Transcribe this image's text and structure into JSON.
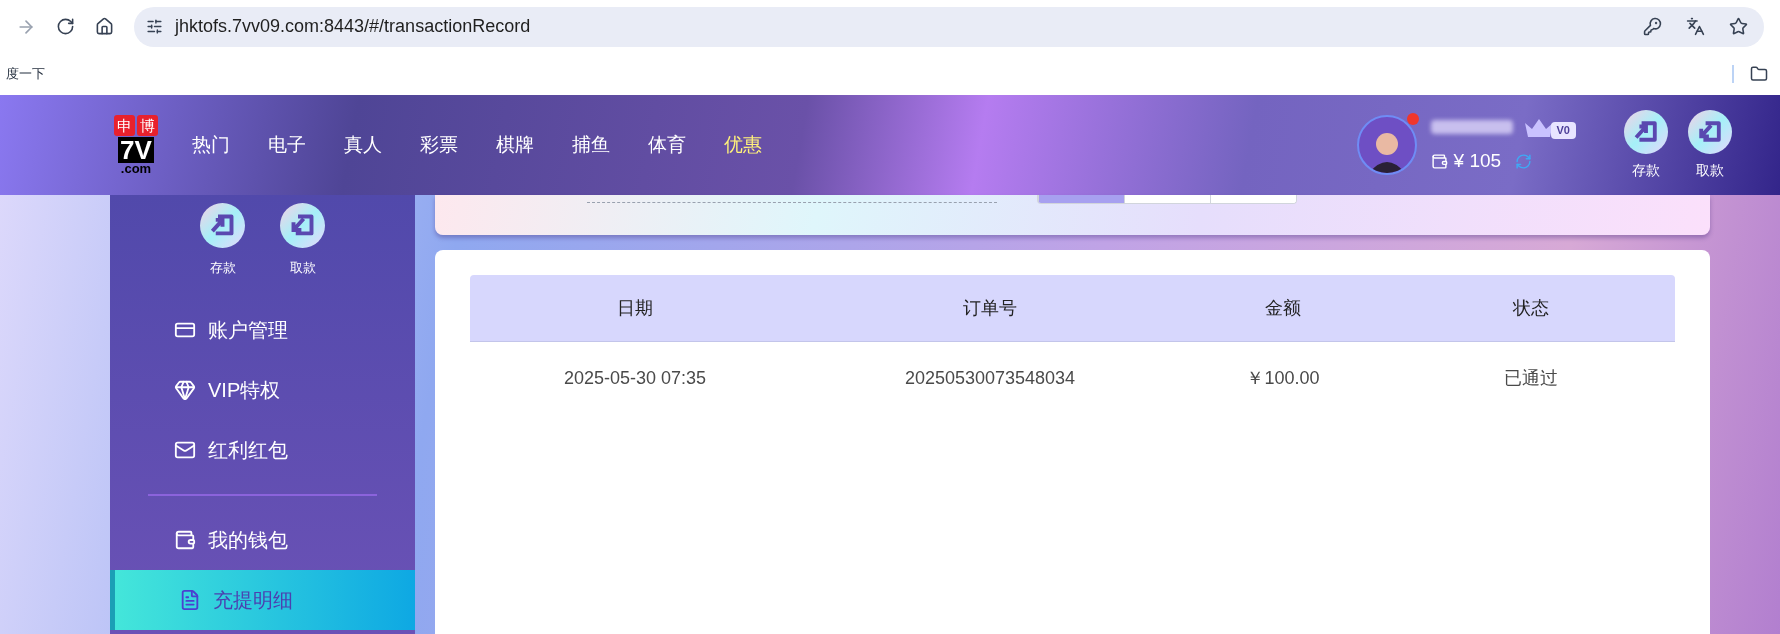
{
  "browser": {
    "url": "jhktofs.7vv09.com:8443/#/transactionRecord",
    "bookmarks": [
      "度一下"
    ]
  },
  "header": {
    "logo": {
      "top": [
        "申",
        "博"
      ],
      "main": "7V",
      "sub": ".com"
    },
    "nav": [
      {
        "label": "热门",
        "highlight": false
      },
      {
        "label": "电子",
        "highlight": false
      },
      {
        "label": "真人",
        "highlight": false
      },
      {
        "label": "彩票",
        "highlight": false
      },
      {
        "label": "棋牌",
        "highlight": false
      },
      {
        "label": "捕鱼",
        "highlight": false
      },
      {
        "label": "体育",
        "highlight": false
      },
      {
        "label": "优惠",
        "highlight": true
      }
    ],
    "user": {
      "notification": true,
      "vip": "V0",
      "balance": "¥ 105"
    },
    "actions": [
      {
        "kind": "deposit",
        "label": "存款"
      },
      {
        "kind": "withdraw",
        "label": "取款"
      }
    ]
  },
  "sidebar": {
    "actions": [
      {
        "kind": "deposit",
        "label": "存款"
      },
      {
        "kind": "withdraw",
        "label": "取款"
      }
    ],
    "groups": [
      [
        {
          "kind": "card",
          "label": "账户管理",
          "selected": false
        },
        {
          "kind": "diamond",
          "label": "VIP特权",
          "selected": false
        },
        {
          "kind": "envelope",
          "label": "红利红包",
          "selected": false
        }
      ],
      [
        {
          "kind": "wallet",
          "label": "我的钱包",
          "selected": false
        },
        {
          "kind": "document",
          "label": "充提明细",
          "selected": true
        }
      ]
    ]
  },
  "filter": {
    "segments": [
      {
        "selected": true
      },
      {
        "selected": false
      },
      {
        "selected": false
      }
    ]
  },
  "table": {
    "columns": [
      "日期",
      "订单号",
      "金额",
      "状态"
    ],
    "rows": [
      [
        "2025-05-30 07:35",
        "20250530073548034",
        "￥100.00",
        "已通过"
      ]
    ]
  }
}
